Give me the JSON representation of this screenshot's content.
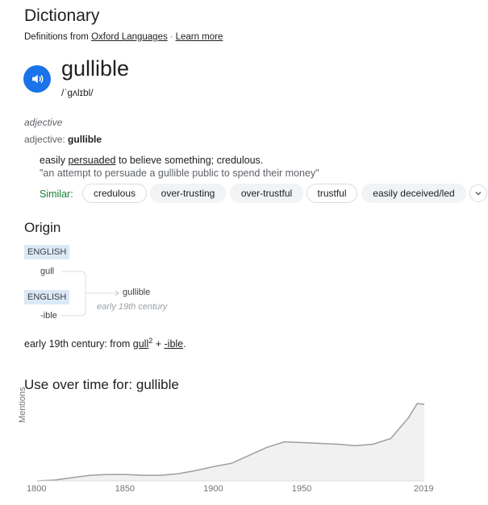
{
  "header": {
    "title": "Dictionary",
    "definitions_from": "Definitions from",
    "source_link": "Oxford Languages",
    "separator": "·",
    "learn_more": "Learn more"
  },
  "entry": {
    "word": "gullible",
    "phonetic": "/ˈɡʌlɪbl/",
    "part_of_speech": "adjective",
    "pos_prefix": "adjective:",
    "pos_word": "gullible",
    "definition_before": "easily ",
    "definition_link": "persuaded",
    "definition_after": " to believe something; credulous.",
    "example": "\"an attempt to persuade a gullible public to spend their money\"",
    "similar_label": "Similar:",
    "similar": [
      "credulous",
      "over-trusting",
      "over-trustful",
      "trustful",
      "easily deceived/led"
    ]
  },
  "origin": {
    "heading": "Origin",
    "lang1": "ENGLISH",
    "word1": "gull",
    "lang2": "ENGLISH",
    "word2": "-ible",
    "result": "gullible",
    "result_date": "early 19th century",
    "text_before": "early 19th century: from ",
    "link1": "gull",
    "sup1": "2",
    "plus": " + ",
    "link2": "-ible",
    "period": "."
  },
  "usage": {
    "heading": "Use over time for: gullible",
    "ylabel": "Mentions"
  },
  "chart_data": {
    "type": "area",
    "title": "Use over time for: gullible",
    "xlabel": "",
    "ylabel": "Mentions",
    "x_ticks": [
      "1800",
      "1850",
      "1900",
      "1950",
      "2019"
    ],
    "xlim": [
      1800,
      2019
    ],
    "ylim": [
      0,
      100
    ],
    "x": [
      1800,
      1810,
      1820,
      1830,
      1840,
      1850,
      1860,
      1870,
      1880,
      1890,
      1900,
      1910,
      1920,
      1930,
      1940,
      1950,
      1960,
      1970,
      1980,
      1990,
      2000,
      2010,
      2015,
      2019
    ],
    "values": [
      0,
      1,
      4,
      7,
      8,
      8,
      7,
      7,
      9,
      13,
      18,
      22,
      32,
      42,
      49,
      48,
      47,
      46,
      44,
      46,
      53,
      79,
      97,
      96
    ]
  }
}
